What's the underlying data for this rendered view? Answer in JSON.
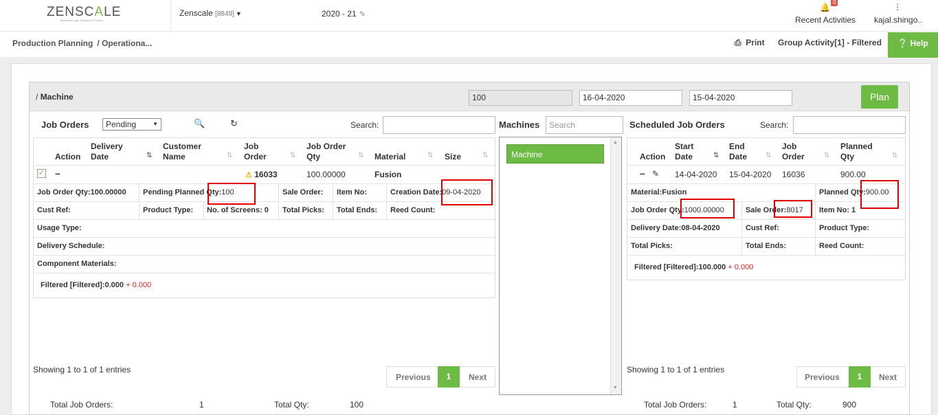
{
  "header": {
    "logo_main": "ZENSC",
    "logo_accent": "A",
    "logo_end": "LE",
    "logo_tag": "Business Logic. Business Process.",
    "company": "Zenscale",
    "company_code": "[8849]",
    "year": "2020 - 21",
    "recent": "Recent Activities",
    "badge": "0",
    "user": "kajal.shingo.."
  },
  "subbar": {
    "crumb1": "Production Planning",
    "crumb2": "/ Operationa...",
    "print": "Print",
    "group": "Group Activity[1] - Filtered",
    "help": "Help"
  },
  "toolbar": {
    "title": "Machine",
    "title_prefix": "/",
    "qty": "100",
    "date_from": "16-04-2020",
    "date_to": "15-04-2020",
    "plan": "Plan"
  },
  "left": {
    "title": "Job Orders",
    "status": "Pending",
    "search_label": "Search:",
    "cols": [
      "Action",
      "Delivery Date",
      "Customer Name",
      "Job Order",
      "Job Order Qty",
      "Material",
      "Size"
    ],
    "row": {
      "job": "16033",
      "qty": "100.00000",
      "material": "Fusion"
    },
    "d": {
      "jo_qty": "Job Order Qty:100.00000",
      "pp_label": "Pending Planned Qty:",
      "pp_val": "100",
      "sale": "Sale Order:",
      "item": "Item No:",
      "cd_label": "Creation Date:",
      "cd_val": "09-04-2020",
      "cust": "Cust Ref:",
      "ptype": "Product Type:",
      "screens": "No. of Screens: 0",
      "picks": "Total Picks:",
      "ends": "Total Ends:",
      "reed": "Reed Count:",
      "usage": "Usage Type:",
      "delivery": "Delivery Schedule:",
      "component": "Component Materials:",
      "filtered": "Filtered [Filtered]:0.000",
      "plus": "+ 0.000"
    },
    "showing": "Showing 1 to 1 of 1 entries",
    "total_jo_label": "Total Job Orders:",
    "total_jo": "1",
    "total_qty_label": "Total Qty:",
    "total_qty": "100"
  },
  "machines": {
    "title": "Machines",
    "search_ph": "Search",
    "item": "Machine"
  },
  "right": {
    "title": "Scheduled Job Orders",
    "search_label": "Search:",
    "cols": [
      "Action",
      "Start Date",
      "End Date",
      "Job Order",
      "Planned Qty"
    ],
    "row": {
      "start": "14-04-2020",
      "end": "15-04-2020",
      "job": "16036",
      "planned": "900.00"
    },
    "d": {
      "material": "Material:Fusion",
      "pq_label": "Planned Qty:",
      "pq_val": "900.00",
      "jo_label": "Job Order Qty:",
      "jo_val": "1000.00000",
      "so_label": "Sale Order:",
      "so_val": "8017",
      "item": "Item No: 1",
      "delivery": "Delivery Date:08-04-2020",
      "cust": "Cust Ref:",
      "ptype": "Product Type:",
      "picks": "Total Picks:",
      "ends": "Total Ends:",
      "reed": "Reed Count:",
      "filtered": "Filtered [Filtered]:100.000",
      "plus": "+ 0.000"
    },
    "showing": "Showing 1 to 1 of 1 entries",
    "total_jo_label": "Total Job Orders:",
    "total_jo": "1",
    "total_qty_label": "Total Qty:",
    "total_qty": "900"
  },
  "pager": {
    "prev": "Previous",
    "page": "1",
    "next": "Next"
  }
}
